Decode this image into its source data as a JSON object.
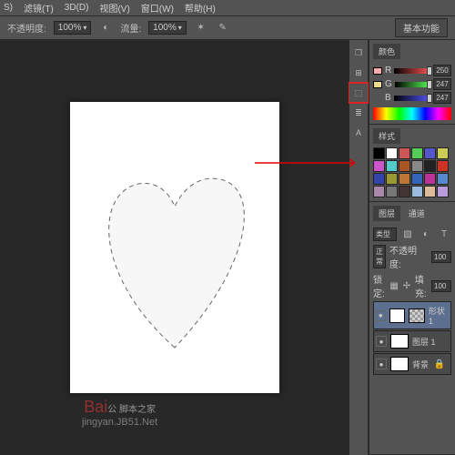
{
  "menu": {
    "items": [
      "S)",
      "滤镜(T)",
      "3D(D)",
      "视图(V)",
      "窗口(W)",
      "帮助(H)"
    ]
  },
  "options": {
    "opacity_label": "不透明度:",
    "opacity_value": "100%",
    "flow_label": "流量:",
    "flow_value": "100%",
    "workspace": "基本功能"
  },
  "color": {
    "title": "颜色",
    "r_label": "R",
    "r_value": "250",
    "g_label": "G",
    "g_value": "247",
    "b_label": "B",
    "b_value": "247"
  },
  "styles": {
    "title": "样式"
  },
  "layers": {
    "tab1": "图层",
    "tab2": "通道",
    "mode_label": "正常",
    "opacity_label": "不透明度:",
    "opacity_value": "100",
    "lock_label": "锁定:",
    "fill_label": "填充:",
    "fill_value": "100",
    "type_label": "类型",
    "items": [
      {
        "name": "形状 1"
      },
      {
        "name": "图层 1"
      },
      {
        "name": "背景"
      }
    ]
  },
  "swatches": [
    "#000",
    "#fff",
    "#c55",
    "#5c5",
    "#55c",
    "#cc5",
    "#c5c",
    "#5cc",
    "#a52",
    "#888",
    "#222",
    "#c32",
    "#34a",
    "#993",
    "#b73",
    "#36b",
    "#b39",
    "#58c",
    "#a8a",
    "#777",
    "#433",
    "#9bd",
    "#db9",
    "#b9d"
  ],
  "watermark": {
    "brand": "Bai",
    "subtitle": "脚本之家",
    "site": "jingyan.JB51.Net"
  }
}
